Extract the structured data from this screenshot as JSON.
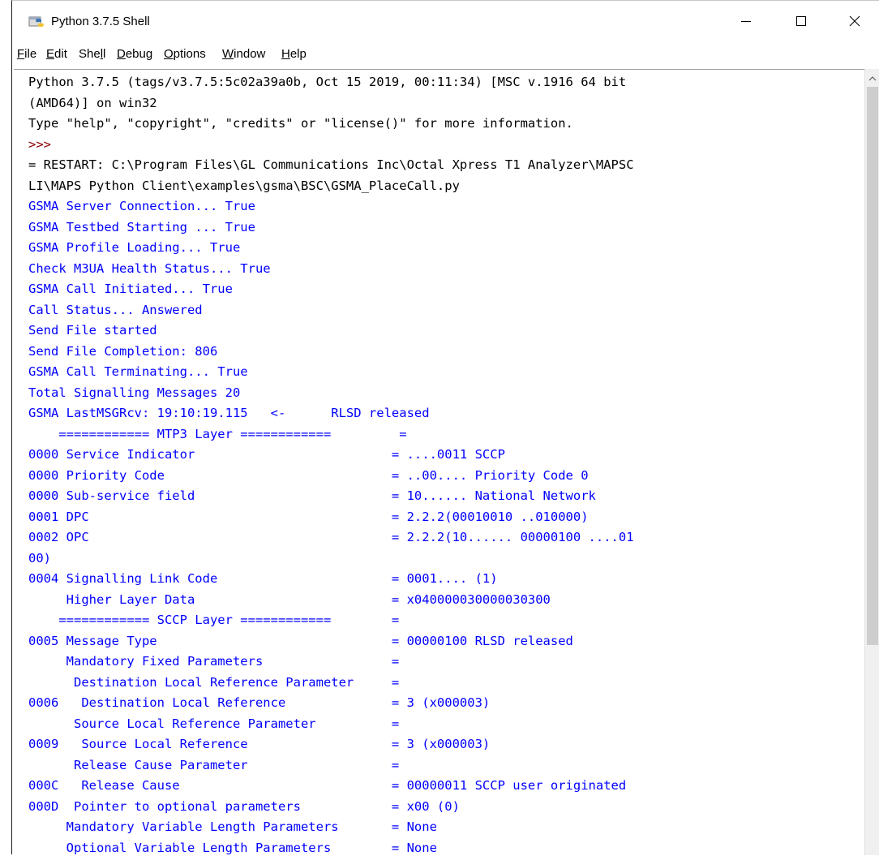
{
  "window": {
    "title": "Python 3.7.5 Shell",
    "app_icon": "python-idle-icon",
    "controls": [
      "minimize-icon",
      "maximize-icon",
      "close-icon"
    ]
  },
  "menubar": {
    "items": [
      {
        "label": "File",
        "mnemonic": "F"
      },
      {
        "label": "Edit",
        "mnemonic": "E"
      },
      {
        "label": "Shell",
        "mnemonic": "l"
      },
      {
        "label": "Debug",
        "mnemonic": "D"
      },
      {
        "label": "Options",
        "mnemonic": "O"
      },
      {
        "label": "Window",
        "mnemonic": "W"
      },
      {
        "label": "Help",
        "mnemonic": "H"
      }
    ]
  },
  "shell": {
    "colors": {
      "stdout": "#0000ff",
      "banner": "#000000",
      "prompt": "#8b0000"
    },
    "lines": [
      {
        "text": "Python 3.7.5 (tags/v3.7.5:5c02a39a0b, Oct 15 2019, 00:11:34) [MSC v.1916 64 bit",
        "kind": "banner"
      },
      {
        "text": "(AMD64)] on win32",
        "kind": "banner"
      },
      {
        "text": "Type \"help\", \"copyright\", \"credits\" or \"license()\" for more information.",
        "kind": "banner"
      },
      {
        "text": ">>> ",
        "kind": "prompt"
      },
      {
        "text": "= RESTART: C:\\Program Files\\GL Communications Inc\\Octal Xpress T1 Analyzer\\MAPSC",
        "kind": "banner"
      },
      {
        "text": "LI\\MAPS Python Client\\examples\\gsma\\BSC\\GSMA_PlaceCall.py",
        "kind": "banner"
      },
      {
        "text": "GSMA Server Connection... True",
        "kind": "stdout"
      },
      {
        "text": "GSMA Testbed Starting ... True",
        "kind": "stdout"
      },
      {
        "text": "GSMA Profile Loading... True",
        "kind": "stdout"
      },
      {
        "text": "Check M3UA Health Status... True",
        "kind": "stdout"
      },
      {
        "text": "GSMA Call Initiated... True",
        "kind": "stdout"
      },
      {
        "text": "Call Status... Answered",
        "kind": "stdout"
      },
      {
        "text": "Send File started",
        "kind": "stdout"
      },
      {
        "text": "Send File Completion: 806",
        "kind": "stdout"
      },
      {
        "text": "GSMA Call Terminating... True",
        "kind": "stdout"
      },
      {
        "text": "Total Signalling Messages 20",
        "kind": "stdout"
      },
      {
        "text": "GSMA LastMSGRcv: 19:10:19.115   <-      RLSD released",
        "kind": "stdout"
      },
      {
        "text": "    ============ MTP3 Layer ============         =",
        "kind": "stdout"
      },
      {
        "text": "0000 Service Indicator                          = ....0011 SCCP",
        "kind": "stdout"
      },
      {
        "text": "0000 Priority Code                              = ..00.... Priority Code 0",
        "kind": "stdout"
      },
      {
        "text": "0000 Sub-service field                          = 10...... National Network",
        "kind": "stdout"
      },
      {
        "text": "0001 DPC                                        = 2.2.2(00010010 ..010000)",
        "kind": "stdout"
      },
      {
        "text": "0002 OPC                                        = 2.2.2(10...... 00000100 ....01",
        "kind": "stdout"
      },
      {
        "text": "00)",
        "kind": "stdout"
      },
      {
        "text": "0004 Signalling Link Code                       = 0001.... (1)",
        "kind": "stdout"
      },
      {
        "text": "     Higher Layer Data                          = x040000030000030300",
        "kind": "stdout"
      },
      {
        "text": "    ============ SCCP Layer ============        =",
        "kind": "stdout"
      },
      {
        "text": "0005 Message Type                               = 00000100 RLSD released",
        "kind": "stdout"
      },
      {
        "text": "     Mandatory Fixed Parameters                 =",
        "kind": "stdout"
      },
      {
        "text": "      Destination Local Reference Parameter     =",
        "kind": "stdout"
      },
      {
        "text": "0006   Destination Local Reference              = 3 (x000003)",
        "kind": "stdout"
      },
      {
        "text": "      Source Local Reference Parameter          =",
        "kind": "stdout"
      },
      {
        "text": "0009   Source Local Reference                   = 3 (x000003)",
        "kind": "stdout"
      },
      {
        "text": "      Release Cause Parameter                   =",
        "kind": "stdout"
      },
      {
        "text": "000C   Release Cause                            = 00000011 SCCP user originated",
        "kind": "stdout"
      },
      {
        "text": "000D  Pointer to optional parameters            = x00 (0)",
        "kind": "stdout"
      },
      {
        "text": "     Mandatory Variable Length Parameters       = None",
        "kind": "stdout"
      },
      {
        "text": "     Optional Variable Length Parameters        = None",
        "kind": "stdout"
      }
    ]
  }
}
